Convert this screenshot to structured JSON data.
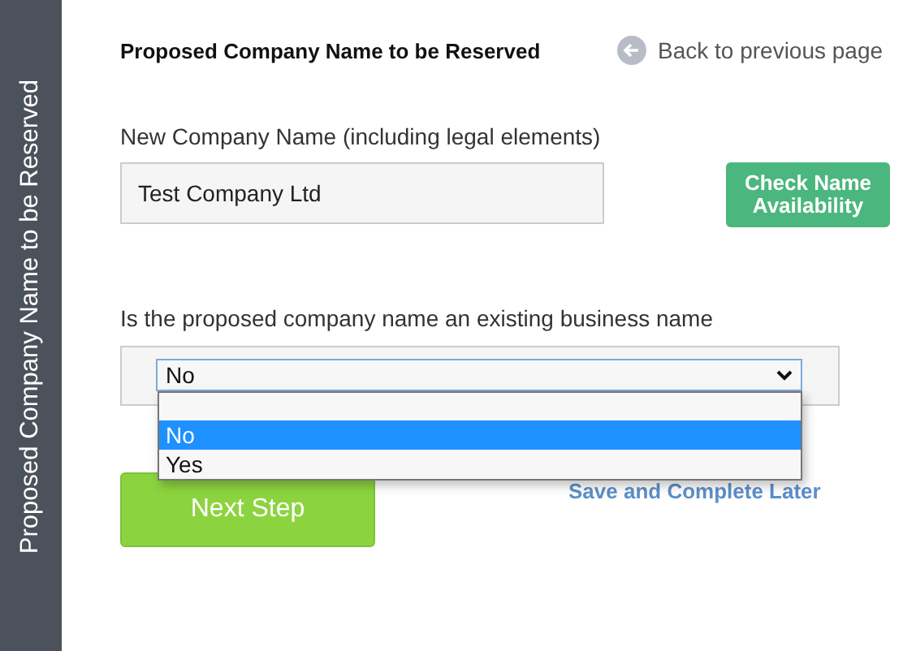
{
  "sidebar": {
    "title": "Proposed Company Name to be Reserved"
  },
  "header": {
    "title": "Proposed Company Name to be Reserved",
    "back_link": "Back to previous page"
  },
  "company_name": {
    "label": "New Company Name (including legal elements)",
    "value": "Test Company Ltd",
    "button": "Check Name Availability"
  },
  "existing_business": {
    "label": "Is the proposed company name an existing business name",
    "value": "No",
    "expanded": true,
    "options": [
      {
        "label": "No",
        "selected": true
      },
      {
        "label": "Yes",
        "selected": false
      }
    ]
  },
  "actions": {
    "next": "Next Step",
    "save_later": "Save and Complete Later"
  }
}
